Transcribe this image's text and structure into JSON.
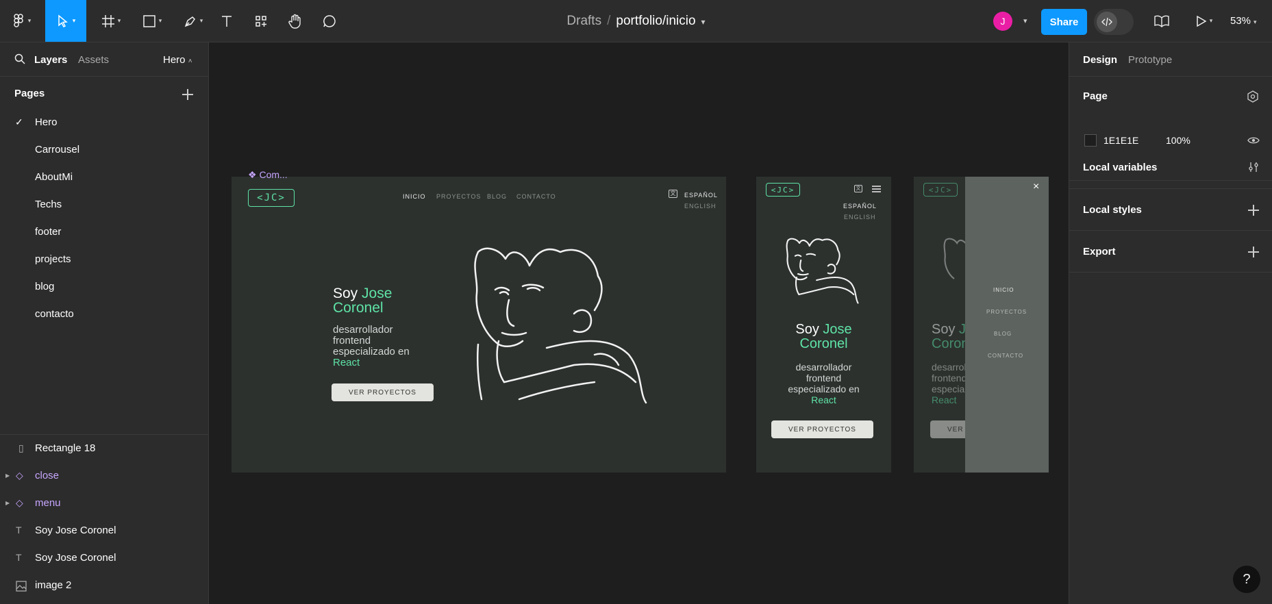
{
  "topbar": {
    "breadcrumb_root": "Drafts",
    "file_name": "portfolio/inicio",
    "avatar_initial": "J",
    "share_label": "Share",
    "zoom": "53%"
  },
  "left_panel": {
    "tabs": [
      "Layers",
      "Assets"
    ],
    "current_page": "Hero",
    "pages_label": "Pages",
    "pages": [
      "Hero",
      "Carrousel",
      "AboutMi",
      "Techs",
      "footer",
      "projects",
      "blog",
      "contacto"
    ],
    "layers": [
      {
        "name": "Rectangle 18",
        "icon": "rectangle-icon"
      },
      {
        "name": "close",
        "icon": "component-icon"
      },
      {
        "name": "menu",
        "icon": "component-icon"
      },
      {
        "name": "Soy Jose Coronel",
        "icon": "text-icon"
      },
      {
        "name": "Soy Jose Coronel",
        "icon": "text-icon"
      },
      {
        "name": "image 2",
        "icon": "image-icon"
      }
    ]
  },
  "right_panel": {
    "tabs": [
      "Design",
      "Prototype"
    ],
    "page_label": "Page",
    "bg_hex": "1E1E1E",
    "bg_opacity": "100%",
    "local_variables": "Local variables",
    "local_styles": "Local styles",
    "export": "Export"
  },
  "canvas": {
    "component_label": "Com...",
    "desktop": {
      "logo": "<JC>",
      "nav": [
        "INICIO",
        "PROYECTOS",
        "BLOG",
        "CONTACTO"
      ],
      "lang_active": "ESPAÑOL",
      "lang_other": "ENGLISH",
      "title_prefix": "Soy",
      "title_name1": "Jose",
      "title_name2": "Coronel",
      "sub_line1": "desarrollador",
      "sub_line2": "frontend",
      "sub_line3": "especializado en",
      "sub_line4": "React",
      "button": "VER PROYECTOS"
    },
    "mobile_menu": [
      "INICIO",
      "PROYECTOS",
      "BLOG",
      "CONTACTO"
    ]
  },
  "colors": {
    "accent": "#0d99ff",
    "brand_green": "#5fe3a6",
    "component": "#c7a6ff"
  }
}
